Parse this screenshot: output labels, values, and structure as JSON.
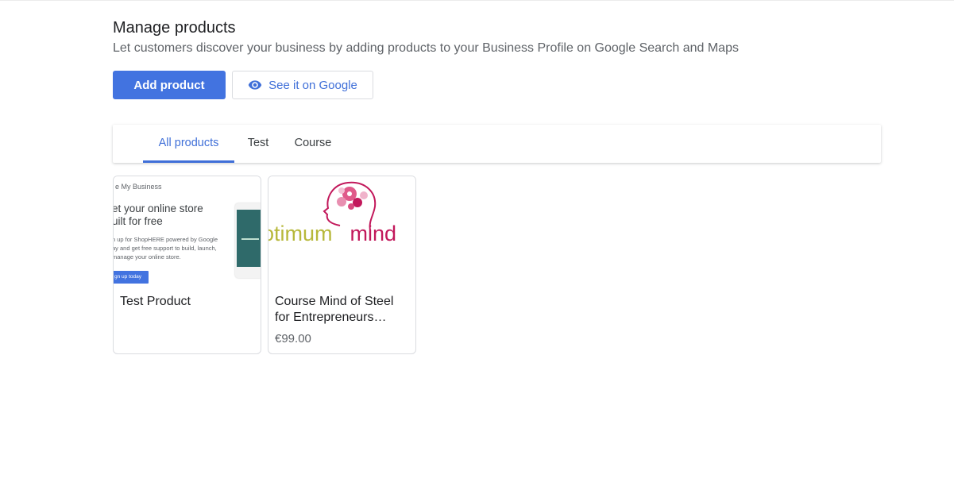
{
  "header": {
    "title": "Manage products",
    "subtitle": "Let customers discover your business by adding products to your Business Profile on Google Search and Maps"
  },
  "actions": {
    "add_label": "Add product",
    "view_label": "See it on Google",
    "view_icon": "eye-icon"
  },
  "tabs": [
    {
      "label": "All products",
      "active": true
    },
    {
      "label": "Test",
      "active": false
    },
    {
      "label": "Course",
      "active": false
    }
  ],
  "products": [
    {
      "name": "Test Product",
      "price": "",
      "thumbnail": {
        "brand": "e My Business",
        "headline": "et your online store uilt for free",
        "body": "n up for ShopHERE powered by Google ay and get free support to build, launch, manage your online store.",
        "cta": "gn up today"
      }
    },
    {
      "name": "Course Mind of Steel for Entrepreneurs Course",
      "price": "€99.00",
      "thumbnail": {
        "logo_left": "otimum",
        "logo_right": "mind"
      }
    }
  ],
  "colors": {
    "accent": "#4273e0",
    "logo_green": "#b7b83a",
    "logo_pink": "#c2185b"
  }
}
